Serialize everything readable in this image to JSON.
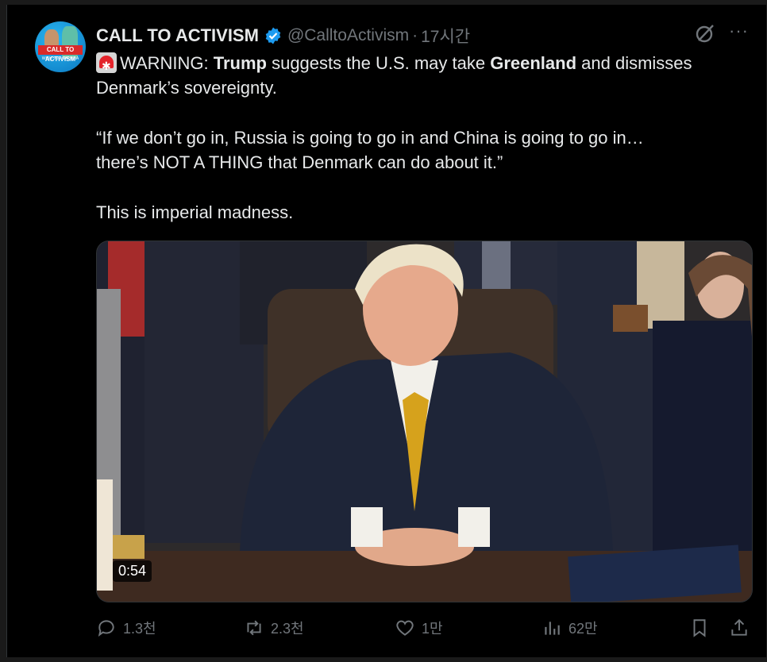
{
  "post": {
    "author_name": "CALL TO ACTIVISM",
    "handle": "@CalltoActivism",
    "separator": "·",
    "time": "17시간",
    "avatar_text": "CALL TO ACTIVISM",
    "avatar_subtext": "WITH JOE GALLINA",
    "line1_prefix": "WARNING: ",
    "line1_bold1": "Trump",
    "line1_mid": " suggests the U.S. may take ",
    "line1_bold2": "Greenland",
    "line1_suffix": " and dismisses",
    "line2": "Denmark’s sovereignty.",
    "quote_line1": "“If we don’t go in, Russia is going to go in and China is going to go in…",
    "quote_line2": "there’s NOT A THING that Denmark can do about it.”",
    "closing": "This is imperial madness.",
    "video_duration": "0:54"
  },
  "actions": {
    "replies": "1.3천",
    "reposts": "2.3천",
    "likes": "1만",
    "views": "62만"
  },
  "colors": {
    "background": "#000000",
    "text": "#e7e9ea",
    "muted": "#71767b",
    "verified_blue": "#1d9bf0",
    "alert_red": "#e3242b"
  },
  "icons": [
    "verified-badge-icon",
    "grok-icon",
    "more-icon",
    "alert-siren-icon",
    "reply-icon",
    "repost-icon",
    "like-icon",
    "views-icon",
    "bookmark-icon",
    "share-icon"
  ]
}
